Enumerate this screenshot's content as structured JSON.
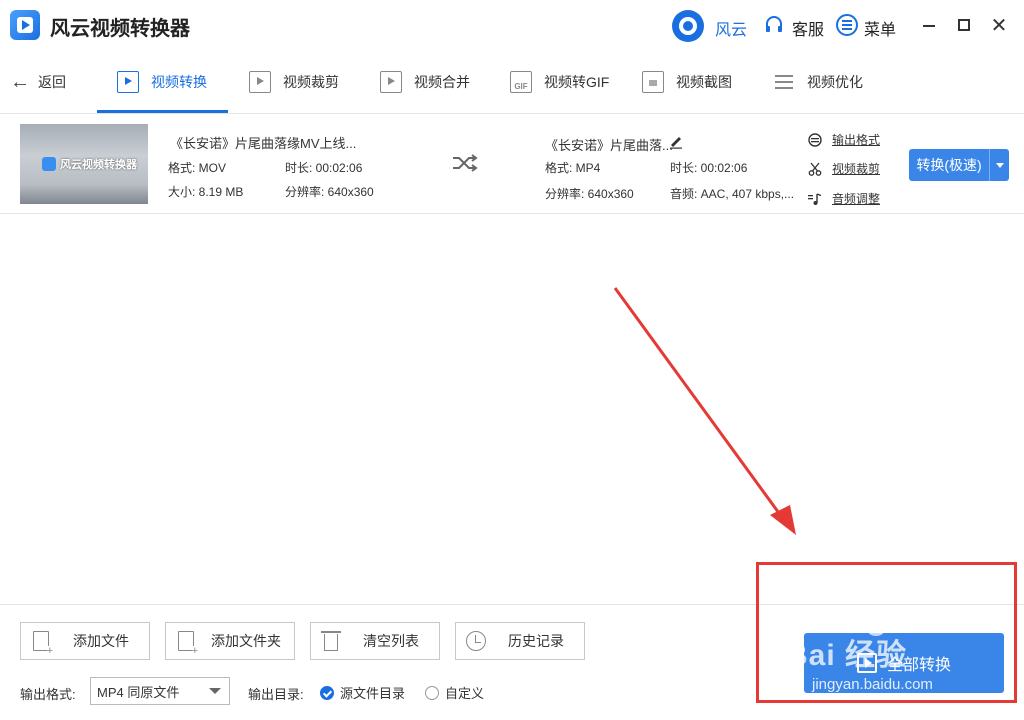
{
  "app": {
    "title": "风云视频转换器",
    "accent_color": "#1a6fe0"
  },
  "titlebar": {
    "user_label": "风云",
    "service_label": "客服",
    "menu_label": "菜单",
    "icons": [
      "app-logo-icon",
      "user-avatar-icon",
      "headset-icon",
      "menu-icon",
      "minimize-icon",
      "maximize-icon",
      "close-icon"
    ]
  },
  "nav": {
    "back_label": "返回",
    "tabs": [
      {
        "label": "视频转换",
        "active": true
      },
      {
        "label": "视频裁剪",
        "active": false
      },
      {
        "label": "视频合并",
        "active": false
      },
      {
        "label": "视频转GIF",
        "active": false
      },
      {
        "label": "视频截图",
        "active": false
      },
      {
        "label": "视频优化",
        "active": false
      }
    ],
    "gif_badge": "GIF"
  },
  "file": {
    "thumb_brand": "风云视频转换器",
    "source": {
      "name": "《长安诺》片尾曲落缘MV上线...",
      "format": "格式: MOV",
      "duration": "时长: 00:02:06",
      "size": "大小: 8.19 MB",
      "resolution": "分辨率: 640x360"
    },
    "output": {
      "name": "《长安诺》片尾曲落...",
      "format": "格式: MP4",
      "duration": "时长: 00:02:06",
      "resolution": "分辨率: 640x360",
      "audio": "音频: AAC, 407 kbps,..."
    },
    "links": {
      "output_format": "输出格式",
      "video_crop": "视频裁剪",
      "audio_adjust": "音频调整"
    },
    "convert_button": "转换(极速)"
  },
  "toolbar": {
    "add_file": "添加文件",
    "add_folder": "添加文件夹",
    "clear_list": "清空列表",
    "history": "历史记录"
  },
  "settings": {
    "output_format_label": "输出格式:",
    "output_format_value": "MP4 同原文件",
    "output_dir_label": "输出目录:",
    "dir_option_source": "源文件目录",
    "dir_option_custom": "自定义",
    "selected_dir_option": "源文件目录"
  },
  "convert_all_button": "全部转换",
  "watermark": {
    "text": "Bai 经验",
    "url": "jingyan.baidu.com"
  },
  "annotation_color": "#e53935"
}
